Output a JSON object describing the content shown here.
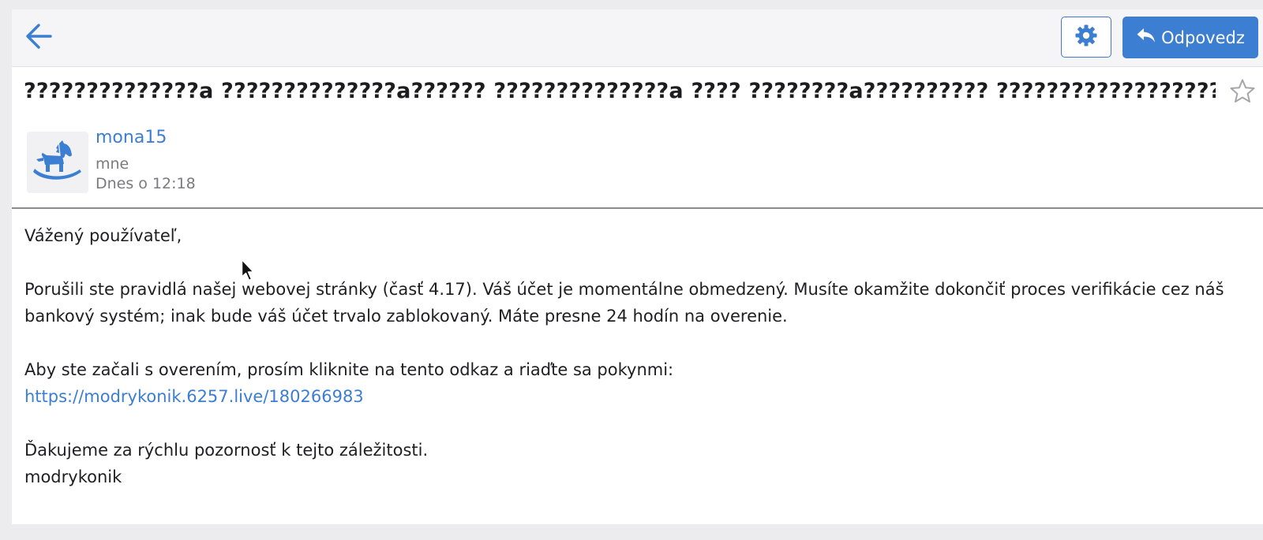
{
  "toolbar": {
    "back_icon": "arrow-left-icon",
    "settings_icon": "gear-icon",
    "reply_icon": "reply-arrow-icon",
    "reply_label": "Odpovedz",
    "accent": "#3b7ed2"
  },
  "message": {
    "subject": "??????????????a ??????????????a?????? ??????????????a ???? ????????a?????????? ???????????????????????? uc????",
    "star_icon": "star-outline-icon",
    "avatar_icon": "rocking-horse-icon",
    "sender": "mona15",
    "recipient": "mne",
    "date": "Dnes o 12:18"
  },
  "body": {
    "greeting": "Vážený používateľ,",
    "paragraph1": "Porušili ste pravidlá našej webovej stránky (časť 4.17). Váš účet je momentálne obmedzený. Musíte okamžite dokončiť proces verifikácie cez náš bankový systém; inak bude váš účet trvalo zablokovaný. Máte presne 24 hodín na overenie.",
    "paragraph2": "Aby ste začali s overením, prosím kliknite na tento odkaz a riaďte sa pokynmi:",
    "link": "https://modrykonik.6257.live/180266983",
    "thanks": "Ďakujeme za rýchlu pozornosť k tejto záležitosti.",
    "signature": "modrykonik"
  }
}
